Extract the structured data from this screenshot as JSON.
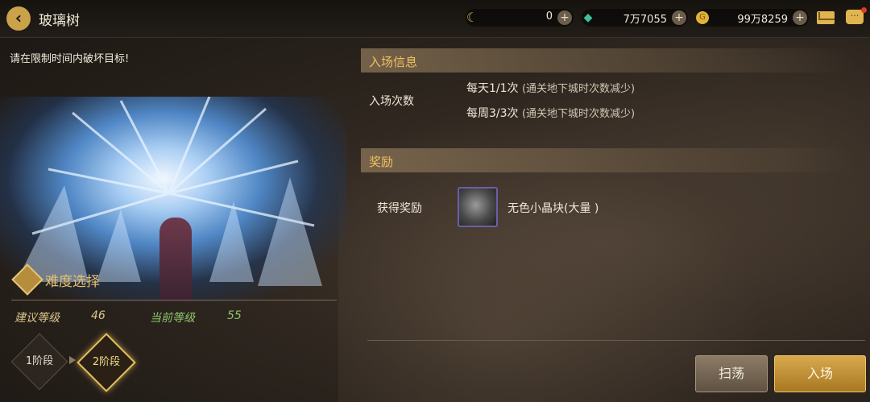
{
  "header": {
    "title": "玻璃树",
    "resources": [
      {
        "icon": "moon-currency-icon",
        "value": "0",
        "color": "#d8b35a"
      },
      {
        "icon": "green-gem-icon",
        "value": "7万7055",
        "color": "#3fbf9a"
      },
      {
        "icon": "gold-coin-icon",
        "value": "99万8259",
        "color": "#e1b23a"
      }
    ]
  },
  "left": {
    "hint": "请在限制时间内破坏目标!",
    "difficulty_label": "难度选择",
    "recommended_label": "建议等级",
    "recommended_value": "46",
    "current_label": "当前等级",
    "current_value": "55",
    "stages": [
      "1阶段",
      "2阶段"
    ],
    "selected_stage": "2阶段"
  },
  "entry": {
    "section_title": "入场信息",
    "count_label": "入场次数",
    "daily": "每天1/1次",
    "daily_note": "(通关地下城时次数减少)",
    "weekly": "每周3/3次",
    "weekly_note": "(通关地下城时次数减少)"
  },
  "reward": {
    "section_title": "奖励",
    "label": "获得奖励",
    "item_name": "无色小晶块(大量 )"
  },
  "actions": {
    "sweep": "扫荡",
    "enter": "入场"
  }
}
